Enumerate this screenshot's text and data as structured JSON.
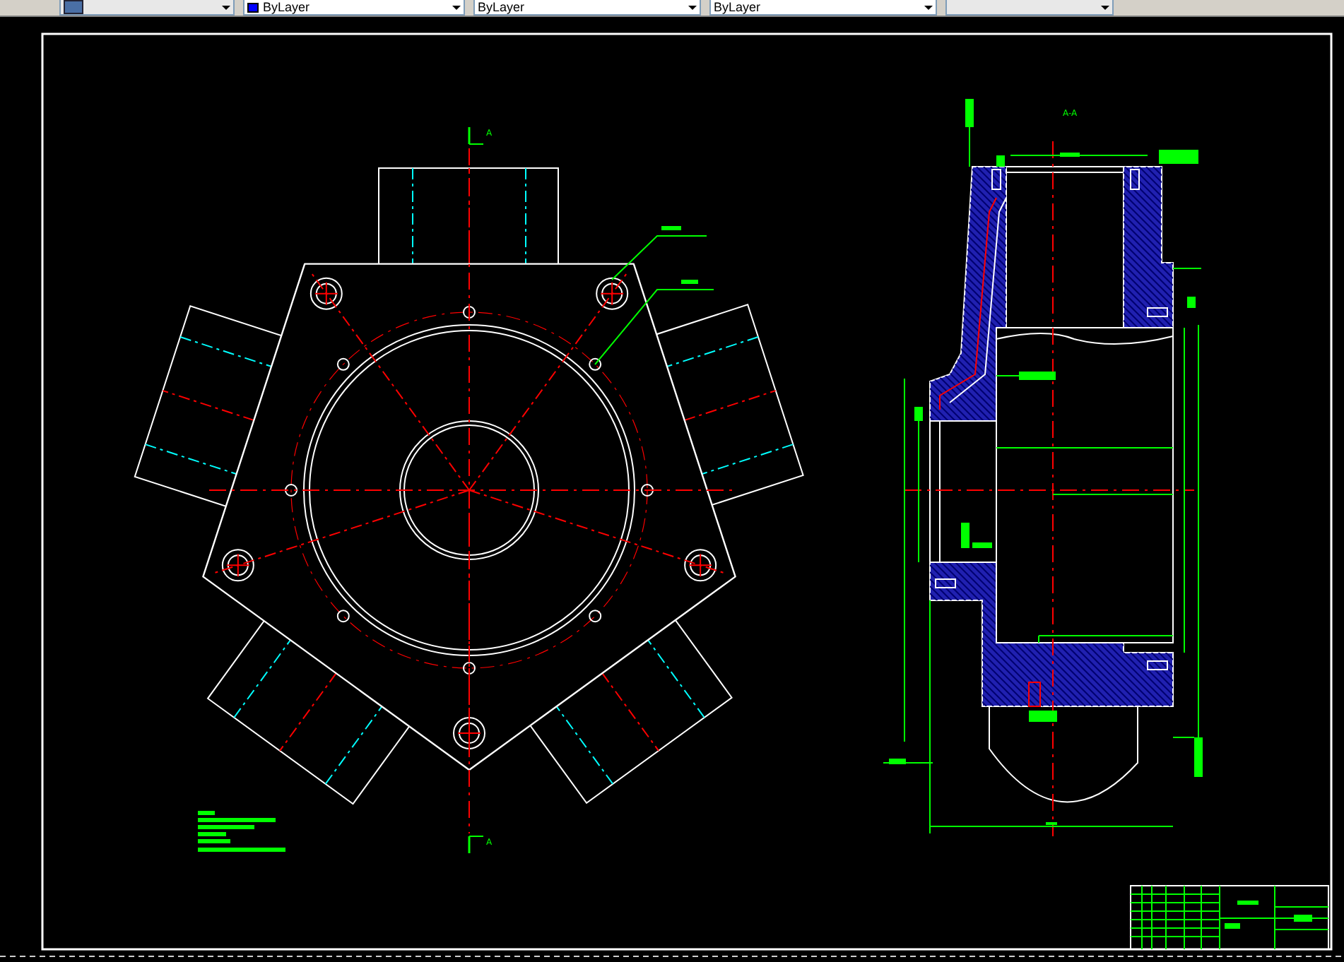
{
  "toolbar": {
    "dropdowns": [
      {
        "kind": "layer"
      },
      {
        "kind": "color",
        "value": "ByLayer",
        "color": "#0000ff"
      },
      {
        "kind": "plain",
        "value": "ByLayer"
      },
      {
        "kind": "plain",
        "value": "ByLayer"
      },
      {
        "kind": "plain"
      }
    ]
  },
  "drawing": {
    "section_marks": [
      {
        "label": "A"
      },
      {
        "label": "A"
      }
    ],
    "section_title": "A-A"
  }
}
